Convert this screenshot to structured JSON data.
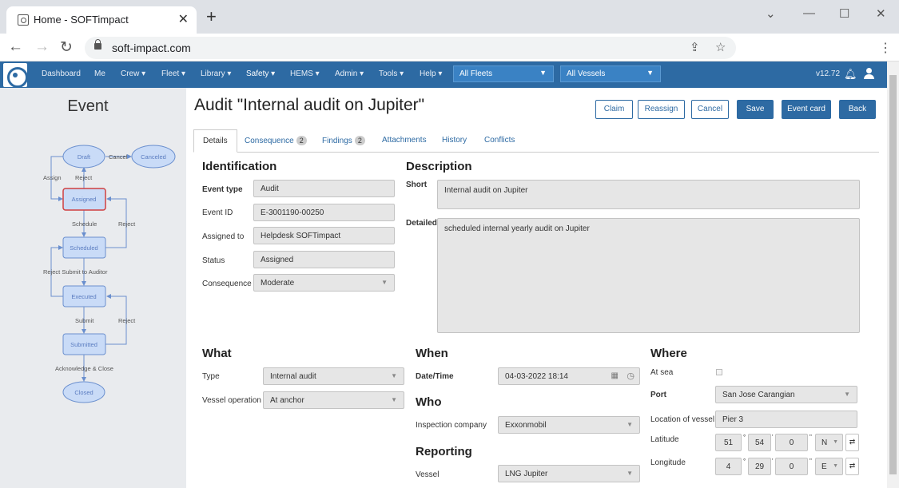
{
  "browser": {
    "tab_title": "Home - SOFTimpact",
    "url": "soft-impact.com"
  },
  "nav": {
    "items": [
      "Dashboard",
      "Me",
      "Crew ▾",
      "Fleet ▾",
      "Library ▾",
      "Safety ▾",
      "HEMS ▾",
      "Admin ▾",
      "Tools ▾",
      "Help ▾"
    ],
    "fleet_select": "All Fleets",
    "vessel_select": "All Vessels",
    "version": "v12.72"
  },
  "left": {
    "title": "Event",
    "flow": {
      "states": [
        "Draft",
        "Canceled",
        "Assigned",
        "Scheduled",
        "Executed",
        "Submitted",
        "Closed"
      ],
      "transitions": [
        "Cancel",
        "Assign",
        "Reject",
        "Schedule",
        "Reject",
        "Reject Submit to Auditor",
        "Submit",
        "Reject",
        "Acknowledge & Close"
      ]
    }
  },
  "page": {
    "title": "Audit \"Internal audit on Jupiter\"",
    "buttons": {
      "claim": "Claim",
      "reassign": "Reassign",
      "cancel": "Cancel",
      "save": "Save",
      "event_card": "Event card",
      "back": "Back"
    }
  },
  "tabs": {
    "details": "Details",
    "consequence": "Consequence",
    "consequence_count": "2",
    "findings": "Findings",
    "findings_count": "2",
    "attachments": "Attachments",
    "history": "History",
    "conflicts": "Conflicts"
  },
  "identification": {
    "heading": "Identification",
    "event_type_label": "Event type",
    "event_type": "Audit",
    "event_id_label": "Event ID",
    "event_id": "E-3001190-00250",
    "assigned_to_label": "Assigned to",
    "assigned_to": "Helpdesk SOFTimpact",
    "status_label": "Status",
    "status": "Assigned",
    "consequence_label": "Consequence",
    "consequence": "Moderate"
  },
  "description": {
    "heading": "Description",
    "short_label": "Short",
    "short": "Internal audit on Jupiter",
    "detailed_label": "Detailed",
    "detailed": "scheduled internal yearly audit on Jupiter"
  },
  "what": {
    "heading": "What",
    "type_label": "Type",
    "type": "Internal audit",
    "vessel_operation_label": "Vessel operation",
    "vessel_operation": "At anchor"
  },
  "when": {
    "heading": "When",
    "datetime_label": "Date/Time",
    "datetime": "04-03-2022 18:14"
  },
  "who": {
    "heading": "Who",
    "inspection_company_label": "Inspection company",
    "inspection_company": "Exxonmobil"
  },
  "reporting": {
    "heading": "Reporting",
    "vessel_label": "Vessel",
    "vessel": "LNG Jupiter"
  },
  "where": {
    "heading": "Where",
    "at_sea_label": "At sea",
    "port_label": "Port",
    "port": "San Jose Carangian",
    "location_label": "Location of vessel",
    "location": "Pier 3",
    "latitude_label": "Latitude",
    "lat_deg": "51",
    "lat_min": "54",
    "lat_sec": "0",
    "lat_dir": "N",
    "longitude_label": "Longitude",
    "lon_deg": "4",
    "lon_min": "29",
    "lon_sec": "0",
    "lon_dir": "E"
  }
}
